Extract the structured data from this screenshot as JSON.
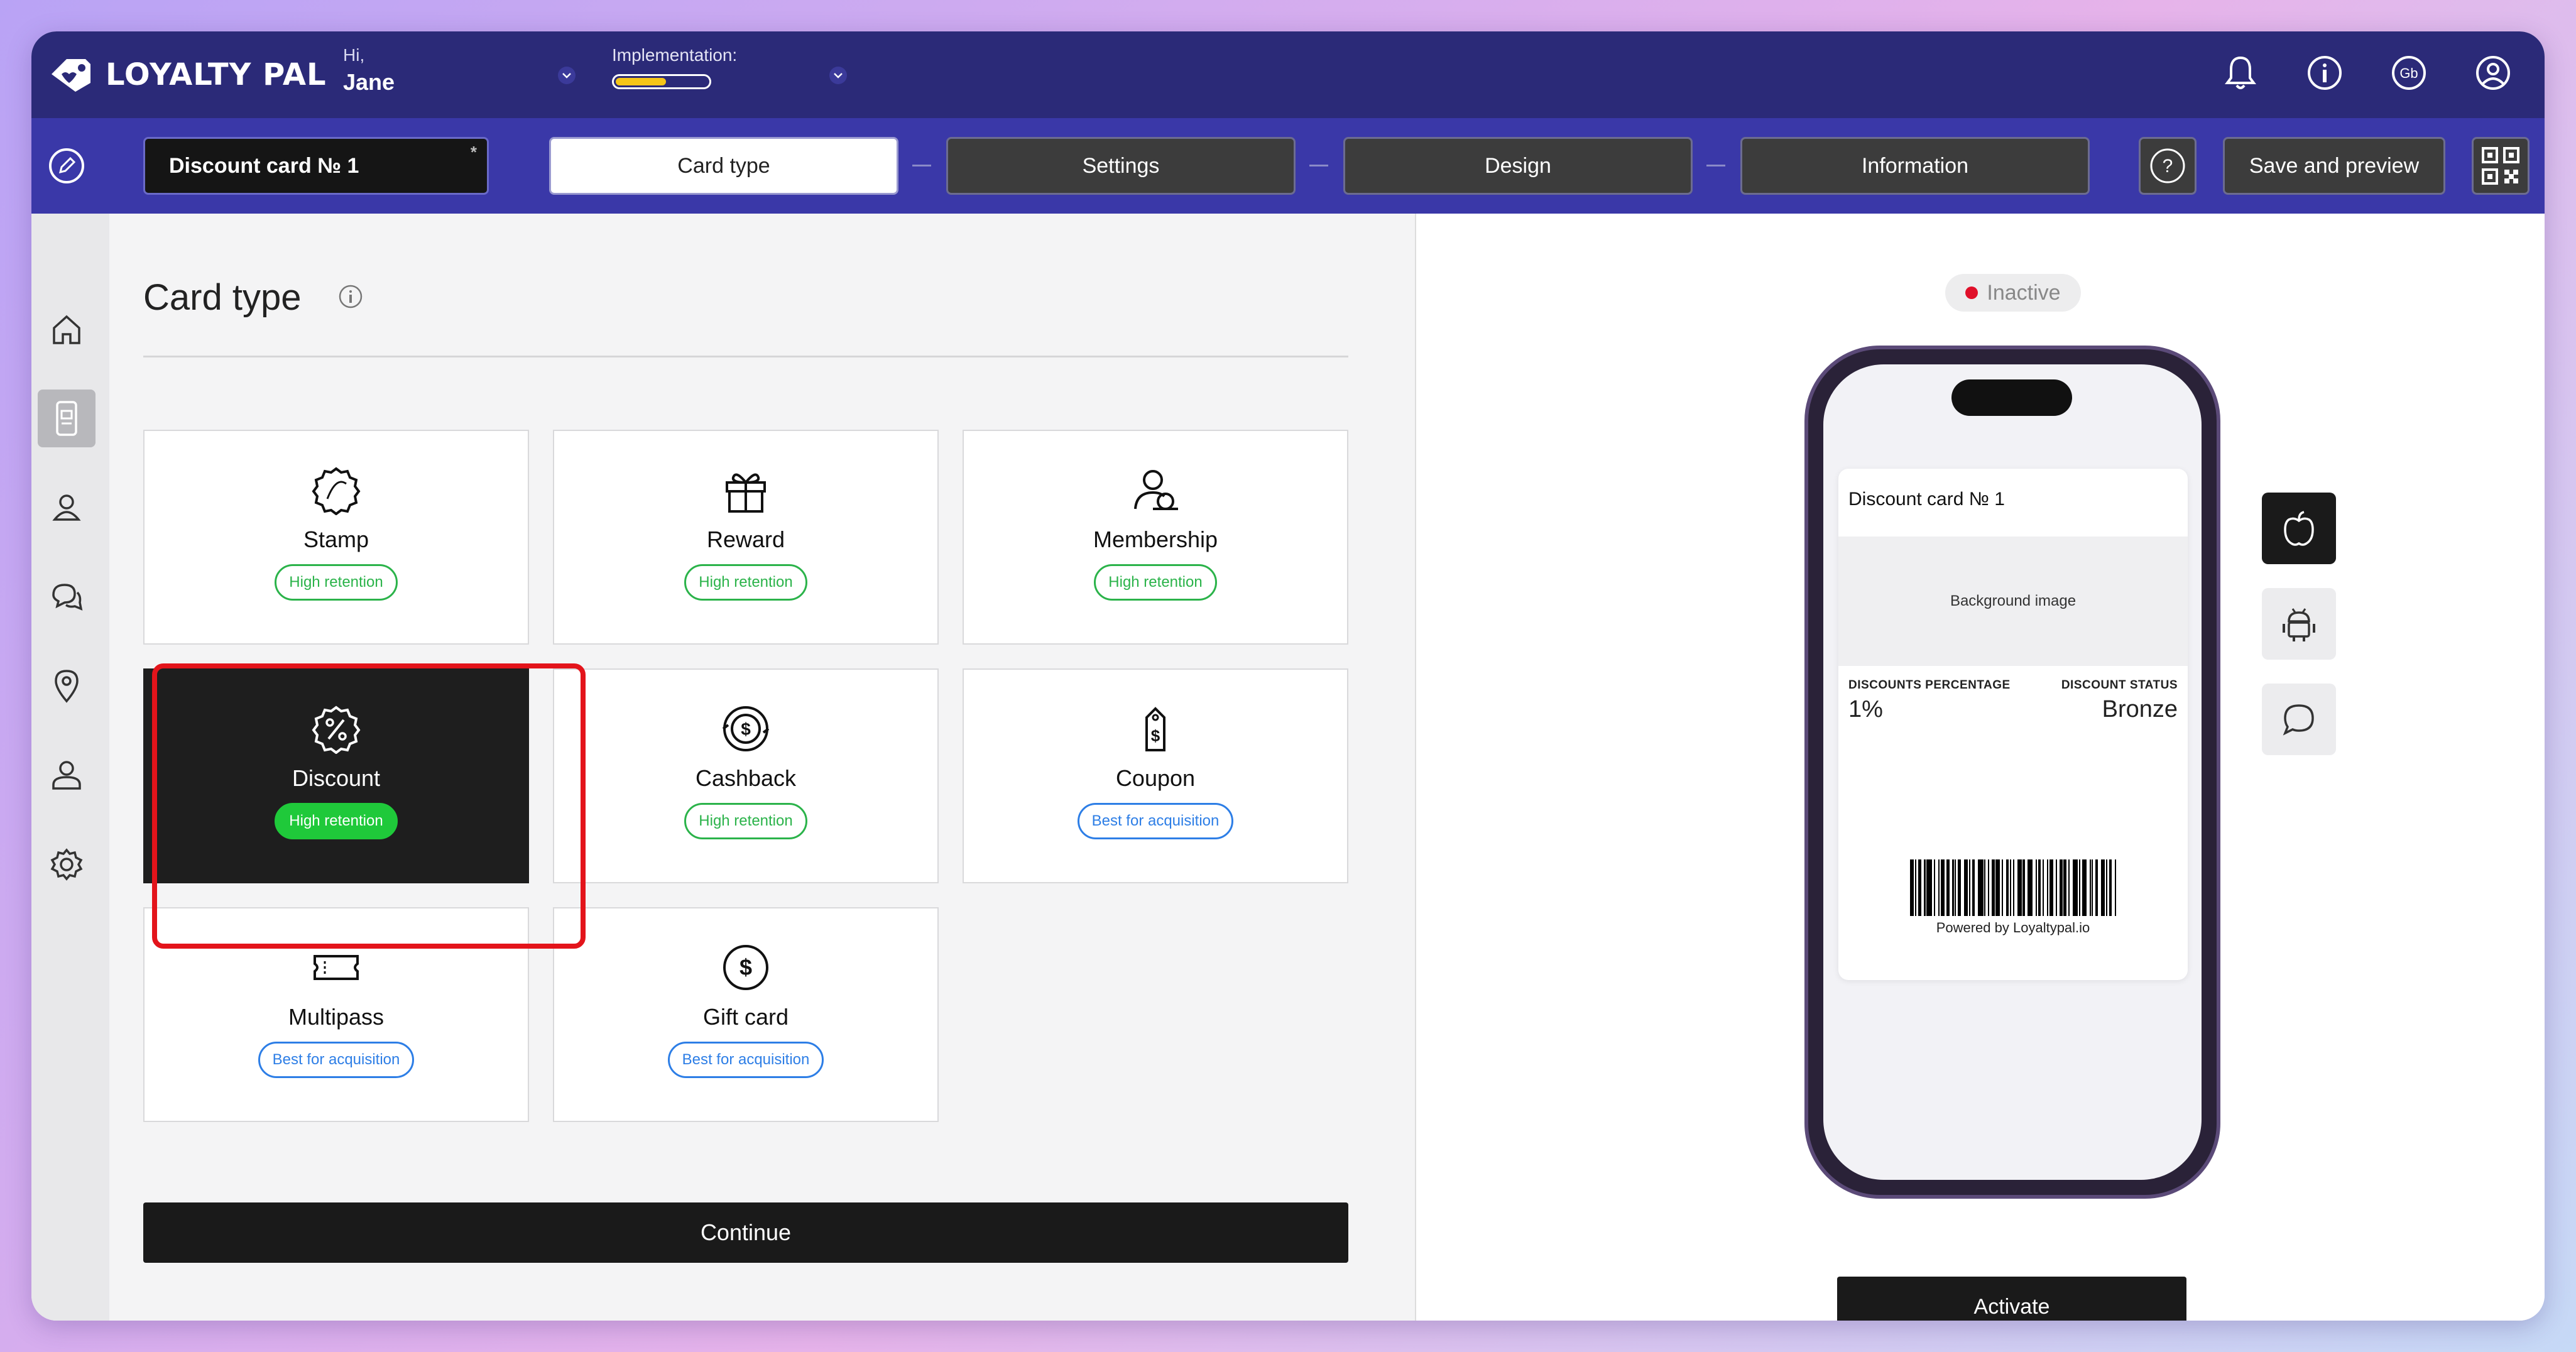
{
  "header": {
    "logo_text": "LOYALTY PAL",
    "greeting": "Hi,",
    "user_name": "Jane",
    "implementation_label": "Implementation:",
    "implementation_progress": 0.55,
    "icons": [
      "bell-icon",
      "info-icon",
      "language-icon",
      "profile-icon"
    ],
    "language_code": "Gb"
  },
  "toolbar": {
    "card_name": "Discount card № 1",
    "unsaved_marker": "*",
    "steps": [
      {
        "label": "Card type",
        "active": true
      },
      {
        "label": "Settings",
        "active": false
      },
      {
        "label": "Design",
        "active": false
      },
      {
        "label": "Information",
        "active": false
      }
    ],
    "help_symbol": "?",
    "save_label": "Save and preview"
  },
  "sidebar": {
    "items": [
      "home-icon",
      "card-icon",
      "clients-icon",
      "chat-icon",
      "location-icon",
      "user-icon",
      "settings-icon"
    ],
    "active_index": 1
  },
  "main": {
    "title": "Card type",
    "card_types": [
      {
        "name": "Stamp",
        "badge": "High retention",
        "badge_kind": "green",
        "icon": "stamp-icon",
        "selected": false
      },
      {
        "name": "Reward",
        "badge": "High retention",
        "badge_kind": "green",
        "icon": "gift-icon",
        "selected": false
      },
      {
        "name": "Membership",
        "badge": "High retention",
        "badge_kind": "green",
        "icon": "membership-icon",
        "selected": false
      },
      {
        "name": "Discount",
        "badge": "High retention",
        "badge_kind": "green",
        "icon": "discount-icon",
        "selected": true
      },
      {
        "name": "Cashback",
        "badge": "High retention",
        "badge_kind": "green",
        "icon": "cashback-icon",
        "selected": false
      },
      {
        "name": "Coupon",
        "badge": "Best for acquisition",
        "badge_kind": "blue",
        "icon": "coupon-icon",
        "selected": false
      },
      {
        "name": "Multipass",
        "badge": "Best for acquisition",
        "badge_kind": "blue",
        "icon": "ticket-icon",
        "selected": false
      },
      {
        "name": "Gift card",
        "badge": "Best for acquisition",
        "badge_kind": "blue",
        "icon": "dollar-icon",
        "selected": false
      }
    ],
    "continue_label": "Continue"
  },
  "preview": {
    "status": "Inactive",
    "status_color": "#e0102a",
    "pass": {
      "name": "Discount card № 1",
      "background_placeholder": "Background image",
      "field_left_label": "DISCOUNTS PERCENTAGE",
      "field_left_value": "1%",
      "field_right_label": "DISCOUNT STATUS",
      "field_right_value": "Bronze",
      "powered_by": "Powered by Loyaltypal.io"
    },
    "platforms": [
      "apple-icon",
      "android-icon",
      "message-icon"
    ],
    "active_platform": 0,
    "activate_label": "Activate"
  },
  "colors": {
    "header_bg": "#2b2a78",
    "toolbar_bg": "#3a38a8",
    "high_retention": "#2bb34a",
    "best_for_acquisition": "#2d7ee6",
    "highlight": "#e3141b"
  }
}
